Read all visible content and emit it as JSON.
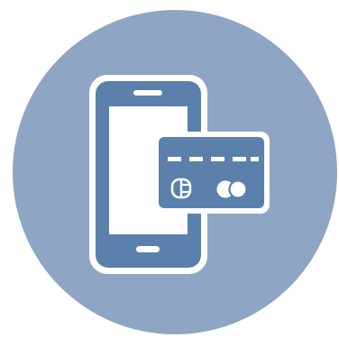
{
  "icon": {
    "name": "mobile-payment-icon",
    "parts": [
      "smartphone-icon",
      "credit-card-icon",
      "card-chip-icon",
      "card-network-logo-icon"
    ]
  },
  "colors": {
    "circle_background": "#8ea6c4",
    "icon_fill": "#5b80ac",
    "icon_outline": "#ffffff",
    "page_background": "#ffffff"
  }
}
